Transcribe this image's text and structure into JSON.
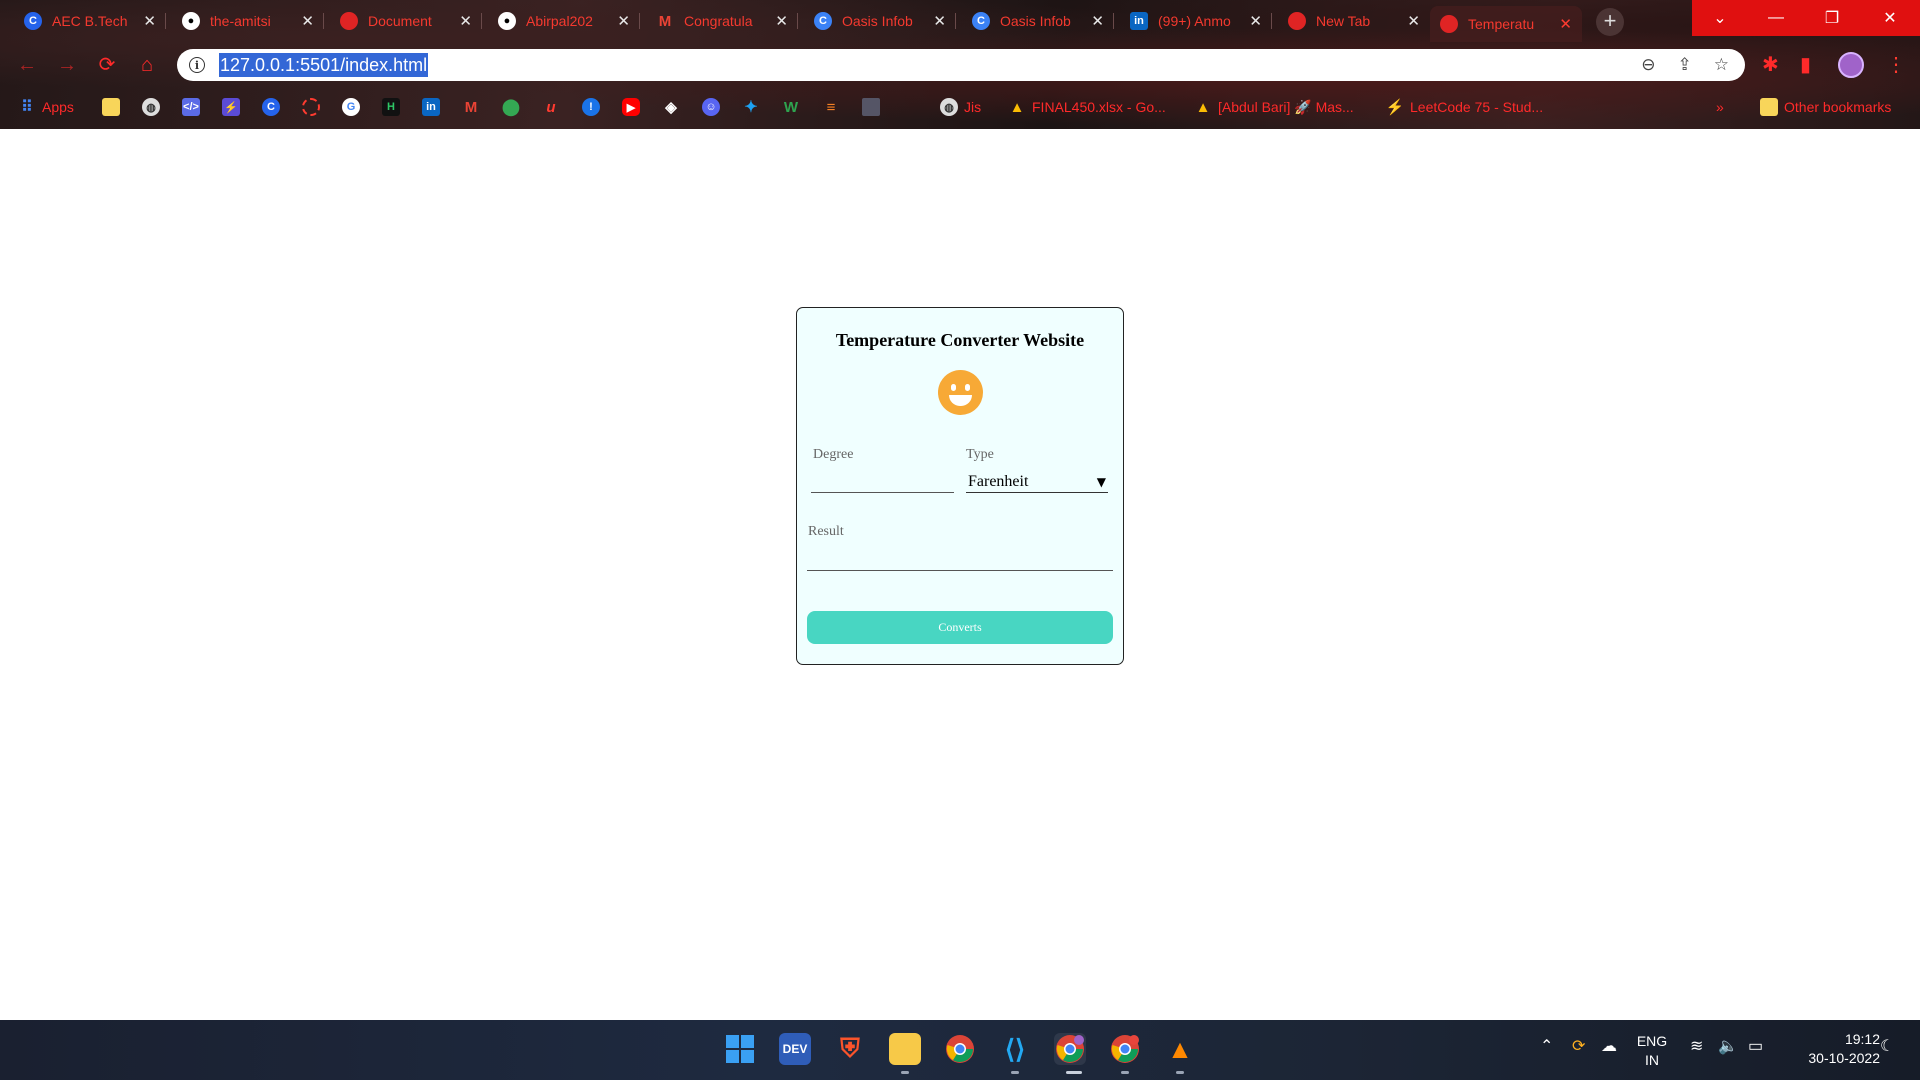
{
  "browser": {
    "tabs": [
      {
        "label": "AEC B.Tech",
        "favicon": "C",
        "color": "#2563eb"
      },
      {
        "label": "the-amitsi",
        "favicon": "github",
        "color": "#ffffff"
      },
      {
        "label": "Document",
        "favicon": "",
        "color": "#e02424"
      },
      {
        "label": "Abirpal202",
        "favicon": "github",
        "color": "#ffffff"
      },
      {
        "label": "Congratula",
        "favicon": "M",
        "color": "#ea4335"
      },
      {
        "label": "Oasis Infob",
        "favicon": "C",
        "color": "#3b82f6"
      },
      {
        "label": "Oasis Infob",
        "favicon": "C",
        "color": "#3b82f6"
      },
      {
        "label": "(99+) Anmo",
        "favicon": "in",
        "color": "#0a66c2"
      },
      {
        "label": "New Tab",
        "favicon": "",
        "color": "#e02424"
      },
      {
        "label": "Temperatu",
        "favicon": "",
        "color": "#e02424"
      }
    ],
    "new_tab": "+",
    "window_controls": {
      "dropdown": "⌄",
      "minimize": "—",
      "restore": "❐",
      "close": "✕"
    },
    "nav": {
      "back": "←",
      "forward": "→",
      "reload": "⟳",
      "home": "⌂"
    },
    "address": {
      "info": "i",
      "url": "127.0.0.1:5501/index.html"
    },
    "omni_icons": {
      "zoom": "⊖",
      "share": "⇪",
      "star": "☆"
    },
    "bookmarks": {
      "apps": "Apps",
      "jis": "Jis",
      "final450": "FINAL450.xlsx - Go...",
      "abdulbari": "[Abdul Bari] 🚀 Mas...",
      "leetcode": "LeetCode 75 - Stud...",
      "more": "»",
      "other": "Other bookmarks"
    }
  },
  "converter": {
    "title": "Temperature Converter Website",
    "degree_label": "Degree",
    "degree_value": "",
    "type_label": "Type",
    "type_selected": "Farenheit",
    "result_label": "Result",
    "result_value": "",
    "button_label": "Converts",
    "colors": {
      "card_bg": "#f0ffff",
      "button_bg": "#48d6c2",
      "emoji": "#f7a936"
    }
  },
  "taskbar": {
    "lang_top": "ENG",
    "lang_bottom": "IN",
    "time": "19:12",
    "date": "30-10-2022"
  }
}
